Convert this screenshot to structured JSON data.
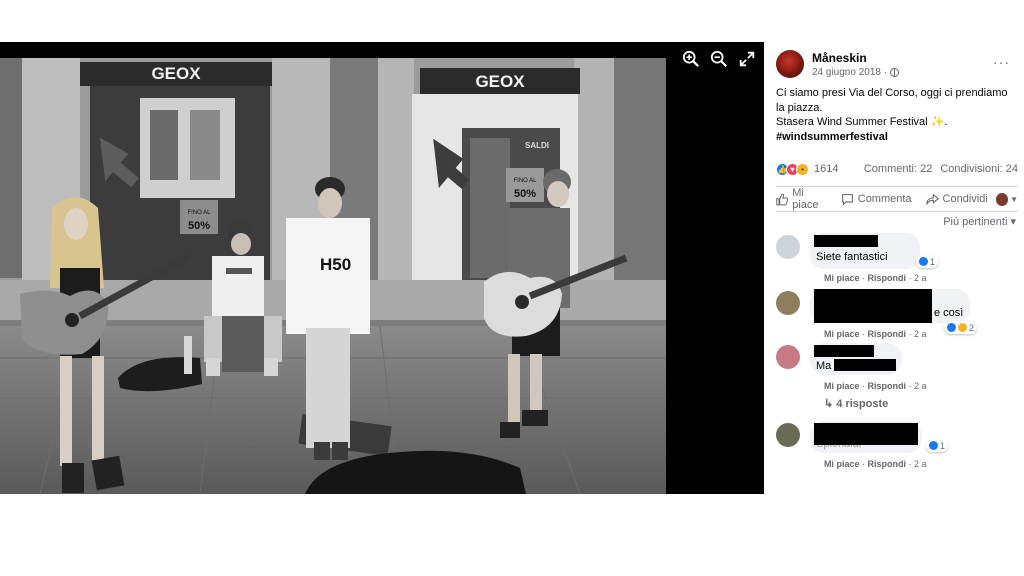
{
  "viewer": {
    "tools": [
      {
        "name": "zoom-in-icon"
      },
      {
        "name": "zoom-out-icon"
      },
      {
        "name": "fullscreen-icon"
      }
    ],
    "photo": {
      "shop_sign_left": "GEOX",
      "shop_sign_right": "GEOX",
      "sale_tag_left_top": "FINO AL",
      "sale_tag_left_value": "50%",
      "sale_tag_right_top": "FINO AL",
      "sale_tag_right_value": "50%",
      "saldi_label": "SALDI",
      "shirt_print": "H50"
    }
  },
  "post": {
    "page_name": "Måneskin",
    "date": "24 giugno 2018 ·",
    "more_label": "···",
    "text_lines": [
      "Ci siamo presi Via del Corso, oggi ci prendiamo",
      "la piazza.",
      "Stasera Wind Summer Festival ✨."
    ],
    "hashtag": "#windsummerfestival",
    "reaction_count": "1614",
    "comments_count": "Commenti: 22",
    "shares_count": "Condivisioni: 24",
    "actions": {
      "like": "Mi piace",
      "comment": "Commenta",
      "share": "Condividi"
    },
    "sort_label": "Più pertinenti ▾",
    "colors": {
      "like": "#1877f2",
      "love": "#f33e58",
      "wow": "#f7b125"
    }
  },
  "comments": [
    {
      "text": "Siete fantastici",
      "reactions": "1",
      "meta_like": "Mi piace",
      "meta_reply": "Rispondi",
      "time": "2 a"
    },
    {
      "text": "e così",
      "reactions": "2",
      "meta_like": "Mi piace",
      "meta_reply": "Rispondi",
      "time": "2 a"
    },
    {
      "text": "Ma",
      "reactions": "",
      "meta_like": "Mi piace",
      "meta_reply": "Rispondi",
      "time": "2 a",
      "replies": "4 risposte"
    },
    {
      "text": "Splendidi",
      "reactions": "1",
      "meta_like": "Mi piace",
      "meta_reply": "Rispondi",
      "time": "2 a"
    }
  ]
}
